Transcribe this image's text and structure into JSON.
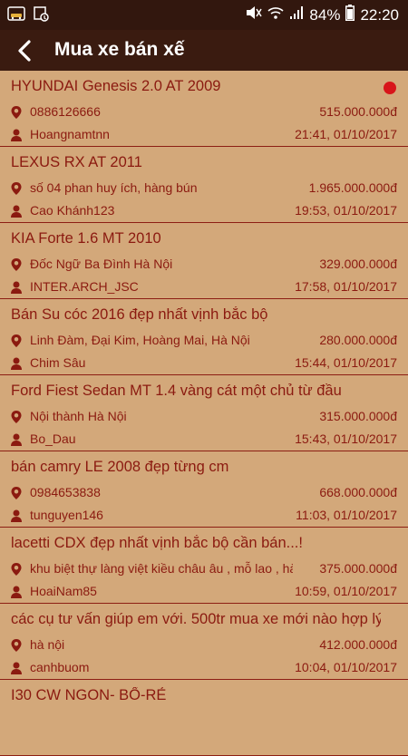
{
  "status_bar": {
    "battery": "84%",
    "time": "22:20"
  },
  "app_bar": {
    "title": "Mua xe bán xế"
  },
  "colors": {
    "background": "#d3a87a",
    "accent": "#8b1a10",
    "header": "#3a1b10",
    "unread_dot": "#d8151a"
  },
  "listings": [
    {
      "title": "HYUNDAI Genesis 2.0 AT 2009",
      "location": "0886126666",
      "price": "515.000.000đ",
      "user": "Hoangnamtnn",
      "time": "21:41, 01/10/2017",
      "unread": true
    },
    {
      "title": "LEXUS RX AT 2011",
      "location": "số 04 phan huy ích, hàng bún",
      "price": "1.965.000.000đ",
      "user": "Cao Khánh123",
      "time": "19:53, 01/10/2017"
    },
    {
      "title": "KIA Forte 1.6 MT 2010",
      "location": "Đốc Ngữ Ba Đình Hà Nội",
      "price": "329.000.000đ",
      "user": "INTER.ARCH_JSC",
      "time": "17:58, 01/10/2017"
    },
    {
      "title": "Bán Su cóc 2016 đẹp nhất vịnh bắc bộ",
      "location": "Linh Đàm, Đại Kim, Hoàng Mai, Hà Nội",
      "price": "280.000.000đ",
      "user": "Chim Sâu",
      "time": "15:44, 01/10/2017"
    },
    {
      "title": "Ford Fiest Sedan MT 1.4 vàng cát một chủ từ đầu",
      "location": "Nội thành Hà Nội",
      "price": "315.000.000đ",
      "user": "Bo_Dau",
      "time": "15:43, 01/10/2017"
    },
    {
      "title": "bán camry LE 2008 đẹp từng cm",
      "location": "0984653838",
      "price": "668.000.000đ",
      "user": "tunguyen146",
      "time": "11:03, 01/10/2017"
    },
    {
      "title": "lacetti CDX đẹp nhất vịnh bắc bộ cần bán...!",
      "location": "khu biệt thự làng việt kiều châu âu , mỗ lao , hà",
      "price": "375.000.000đ",
      "user": "HoaiNam85",
      "time": "10:59, 01/10/2017"
    },
    {
      "title": "các cụ tư vấn giúp em với. 500tr mua xe mới nào hợp lý",
      "location": "hà nội",
      "price": "412.000.000đ",
      "user": "canhbuom",
      "time": "10:04, 01/10/2017"
    },
    {
      "title": "I30 CW NGON- BỔ-RẺ",
      "location": "",
      "price": "",
      "user": "",
      "time": ""
    }
  ]
}
